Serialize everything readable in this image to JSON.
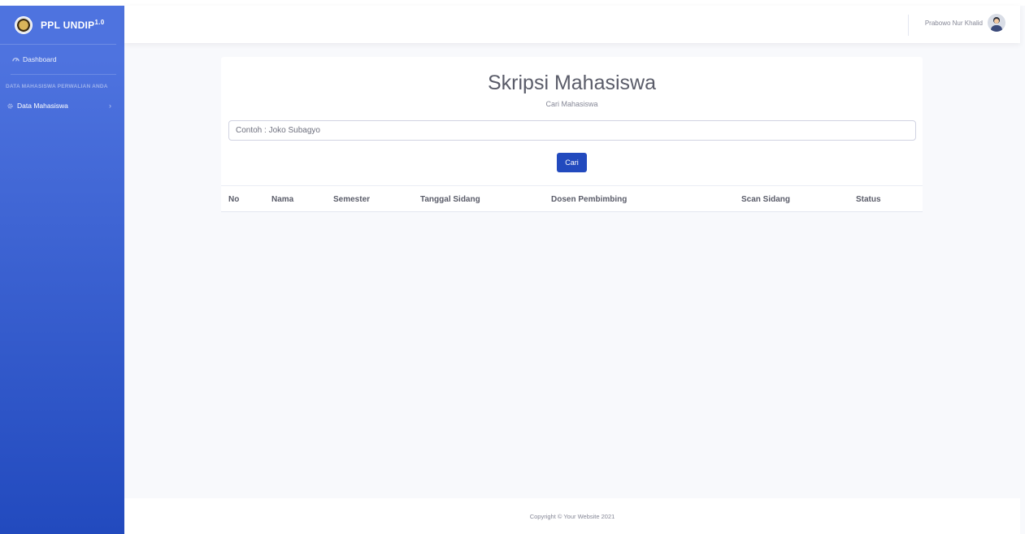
{
  "brand": {
    "name": "PPL UNDIP",
    "version": "1.0"
  },
  "sidebar": {
    "dashboard_label": "Dashboard",
    "section_heading": "DATA MAHASISWA PERWALIAN ANDA",
    "data_mahasiswa_label": "Data Mahasiswa"
  },
  "topbar": {
    "user_name": "Prabowo Nur Khalid"
  },
  "main": {
    "title": "Skripsi Mahasiswa",
    "subtitle": "Cari Mahasiswa",
    "search_placeholder": "Contoh : Joko Subagyo",
    "search_button": "Cari",
    "table": {
      "headers": [
        "No",
        "Nama",
        "Semester",
        "Tanggal Sidang",
        "Dosen Pembimbing",
        "Scan Sidang",
        "Status"
      ],
      "rows": []
    }
  },
  "footer": {
    "copyright": "Copyright © Your Website 2021"
  },
  "colors": {
    "sidebar_top": "#4e73df",
    "sidebar_bottom": "#224abe",
    "button": "#224abe",
    "background": "#f8f9fc"
  }
}
